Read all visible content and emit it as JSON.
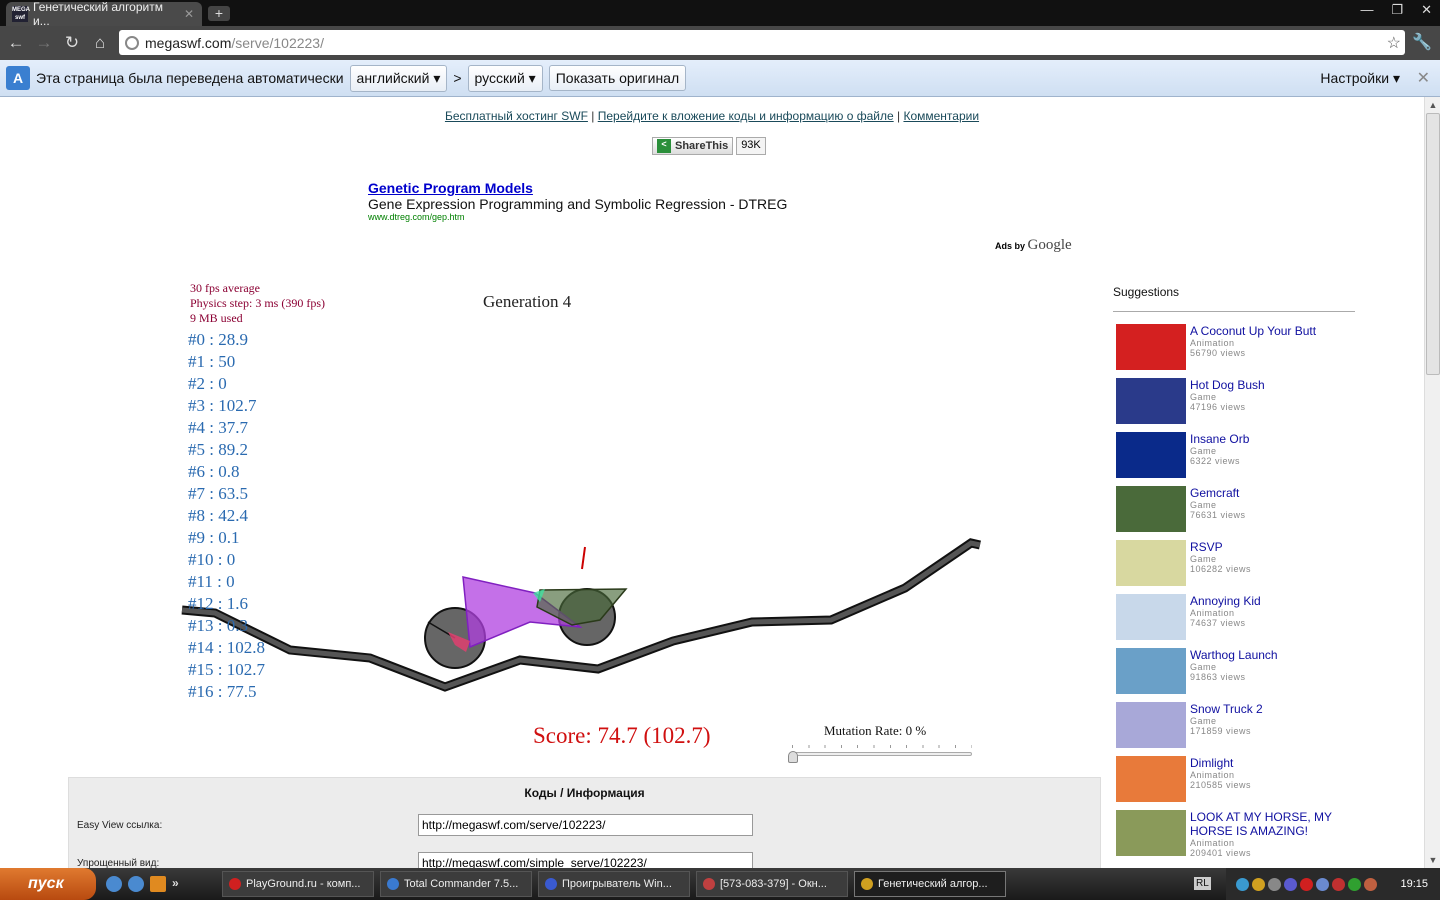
{
  "browser": {
    "tab_title": "Генетический алгоритм и...",
    "favicon_text": "MEGA SWF",
    "url_host": "megaswf.com",
    "url_path": "/serve/102223/"
  },
  "translate_bar": {
    "message": "Эта страница была переведена автоматически",
    "from_lang": "английский",
    "to_lang": "русский",
    "arrow": ">",
    "show_original": "Показать оригинал",
    "settings": "Настройки"
  },
  "page": {
    "links": [
      "Бесплатный хостинг SWF",
      "Перейдите к вложение коды и информацию о файле",
      "Комментарии"
    ],
    "share": {
      "label": "ShareThis",
      "count": "93K"
    },
    "ad": {
      "title": "Genetic Program Models",
      "desc": "Gene Expression Programming and Symbolic Regression - DTREG",
      "url": "www.dtreg.com/gep.htm",
      "ads_by": "Ads by",
      "google": "Google"
    },
    "game": {
      "stats": [
        "30 fps average",
        "Physics step: 3 ms (390 fps)",
        "9 MB used"
      ],
      "generation": "Generation 4",
      "scores": [
        "#0 : 28.9",
        "#1 : 50",
        "#2 : 0",
        "#3 : 102.7",
        "#4 : 37.7",
        "#5 : 89.2",
        "#6 : 0.8",
        "#7 : 63.5",
        "#8 : 42.4",
        "#9 : 0.1",
        "#10 : 0",
        "#11 : 0",
        "#12 : 1.6",
        "#13 : 0.3",
        "#14 : 102.8",
        "#15 : 102.7",
        "#16 : 77.5"
      ],
      "score": "Score: 74.7 (102.7)",
      "mutation_label": "Mutation Rate: 0 %",
      "mutation_rate": 0
    },
    "codes": {
      "title": "Коды / Информация",
      "easy_label": "Easy View ссылка:",
      "easy_value": "http://megaswf.com/serve/102223/",
      "simple_label": "Упрощенный вид:",
      "simple_value": "http://megaswf.com/simple_serve/102223/"
    },
    "suggestions": {
      "title": "Suggestions",
      "items": [
        {
          "name": "A Coconut Up Your Butt",
          "cat": "Animation",
          "views": "56790 views",
          "color": "#d42020"
        },
        {
          "name": "Hot Dog Bush",
          "cat": "Game",
          "views": "47196 views",
          "color": "#2a3a8a"
        },
        {
          "name": "Insane Orb",
          "cat": "Game",
          "views": "6322 views",
          "color": "#0a2a8a"
        },
        {
          "name": "Gemcraft",
          "cat": "Game",
          "views": "76631 views",
          "color": "#4a6a3a"
        },
        {
          "name": "RSVP",
          "cat": "Game",
          "views": "106282 views",
          "color": "#d8d8a0"
        },
        {
          "name": "Annoying Kid",
          "cat": "Animation",
          "views": "74637 views",
          "color": "#c8d8ea"
        },
        {
          "name": "Warthog Launch",
          "cat": "Game",
          "views": "91863 views",
          "color": "#6aa0c8"
        },
        {
          "name": "Snow Truck 2",
          "cat": "Game",
          "views": "171859 views",
          "color": "#a8a8d8"
        },
        {
          "name": "Dimlight",
          "cat": "Animation",
          "views": "210585 views",
          "color": "#e87a3a"
        },
        {
          "name": "LOOK AT MY HORSE, MY HORSE IS AMAZING!",
          "cat": "Animation",
          "views": "209401 views",
          "color": "#8a9a5a"
        }
      ]
    }
  },
  "taskbar": {
    "start": "пуск",
    "tasks": [
      "PlayGround.ru - комп...",
      "Total Commander 7.5...",
      "Проигрыватель Win...",
      "[573-083-379] - Окн...",
      "Генетический алгор..."
    ],
    "lang": "RL",
    "clock": "19:15"
  }
}
